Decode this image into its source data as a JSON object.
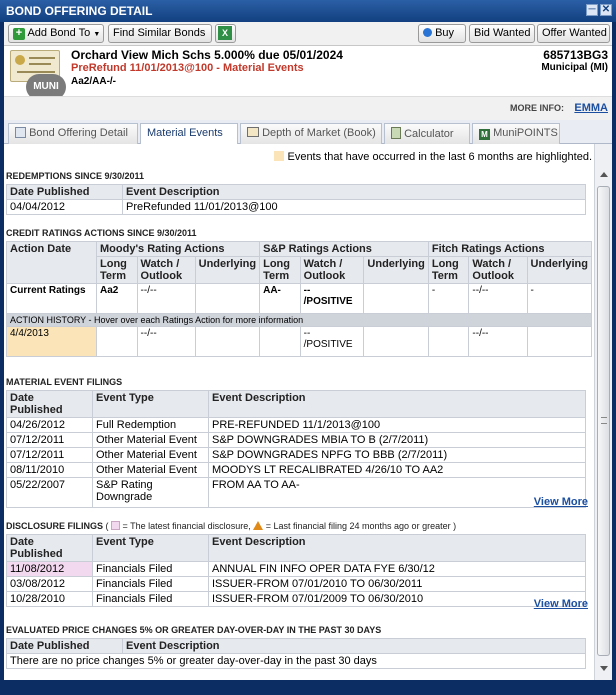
{
  "window": {
    "title": "BOND OFFERING DETAIL"
  },
  "toolbar": {
    "add_bond": "Add Bond To",
    "find_similar": "Find Similar Bonds",
    "buy": "Buy",
    "bid_wanted": "Bid Wanted",
    "offer_wanted": "Offer Wanted"
  },
  "bond": {
    "name": "Orchard View Mich Schs  5.000% due 05/01/2024",
    "refund": "PreRefund 11/01/2013@100 - Material Events",
    "rating": "Aa2/AA-/-",
    "cusip": "685713BG3",
    "type": "Municipal (MI)",
    "badge": "MUNI",
    "more_info_label": "MORE INFO:",
    "more_info_link": "EMMA"
  },
  "tabs": [
    "Bond Offering Detail",
    "Material Events",
    "Depth of Market (Book)",
    "Calculator",
    "MuniPOINTS"
  ],
  "legend_note": "Events that have occurred in the last 6 months are highlighted.",
  "redemptions": {
    "title": "REDEMPTIONS SINCE 9/30/2011",
    "headers": [
      "Date Published",
      "Event Description"
    ],
    "rows": [
      [
        "04/04/2012",
        "PreRefunded 11/01/2013@100"
      ]
    ]
  },
  "credit": {
    "title": "CREDIT RATINGS ACTIONS SINCE 9/30/2011",
    "groups": [
      "Moody's Rating Actions",
      "S&P Ratings Actions",
      "Fitch Ratings Actions"
    ],
    "action_date": "Action Date",
    "sub1": "Long Term",
    "sub2": "Watch / Outlook",
    "sub3": "Underlying",
    "current_label": "Current Ratings",
    "current": [
      "Aa2",
      "--/--",
      "",
      "AA-",
      "--",
      "/POSITIVE",
      "",
      "-",
      "--/--",
      "-"
    ],
    "history_note": "ACTION HISTORY - Hover over each Ratings Action for more information",
    "history_date": "4/4/2013",
    "history": [
      "",
      "--/--",
      "",
      "",
      "--",
      "/POSITIVE",
      "",
      "",
      "--/--",
      ""
    ]
  },
  "filings": {
    "title": "MATERIAL EVENT FILINGS",
    "headers": [
      "Date Published",
      "Event Type",
      "Event Description"
    ],
    "rows": [
      [
        "04/26/2012",
        "Full Redemption",
        "PRE-REFUNDED 11/1/2013@100"
      ],
      [
        "07/12/2011",
        "Other Material Event",
        "S&P DOWNGRADES MBIA TO B (2/7/2011)"
      ],
      [
        "07/12/2011",
        "Other Material Event",
        "S&P DOWNGRADES NPFG TO BBB (2/7/2011)"
      ],
      [
        "08/11/2010",
        "Other Material Event",
        "MOODYS LT RECALIBRATED 4/26/10 TO AA2"
      ],
      [
        "05/22/2007",
        "S&P Rating Downgrade",
        "FROM AA TO AA-"
      ]
    ],
    "view_more": "View More"
  },
  "disclosure": {
    "title_a": "DISCLOSURE FILINGS",
    "title_b": "( ",
    "title_c": " = The latest financial disclosure, ",
    "title_d": " = Last financial filing 24 months ago or greater )",
    "headers": [
      "Date Published",
      "Event Type",
      "Event Description"
    ],
    "rows": [
      [
        "11/08/2012",
        "Financials Filed",
        "ANNUAL FIN INFO OPER DATA FYE 6/30/12"
      ],
      [
        "03/08/2012",
        "Financials Filed",
        "ISSUER-FROM 07/01/2010 TO 06/30/2011"
      ],
      [
        "10/28/2010",
        "Financials Filed",
        "ISSUER-FROM 07/01/2009 TO 06/30/2010"
      ]
    ],
    "view_more": "View More"
  },
  "price_changes": {
    "title": "EVALUATED PRICE CHANGES 5% OR GREATER DAY-OVER-DAY IN THE PAST 30 DAYS",
    "headers": [
      "Date Published",
      "Event Description"
    ],
    "empty": "There are no price changes 5% or greater day-over-day in the past 30 days"
  },
  "colors": {
    "title_bar": "#12407f",
    "refund_red": "#c0392b",
    "highlight": "#fbe5b8",
    "latest_filing": "#f3d9ef",
    "link_blue": "#1c4fa0"
  }
}
